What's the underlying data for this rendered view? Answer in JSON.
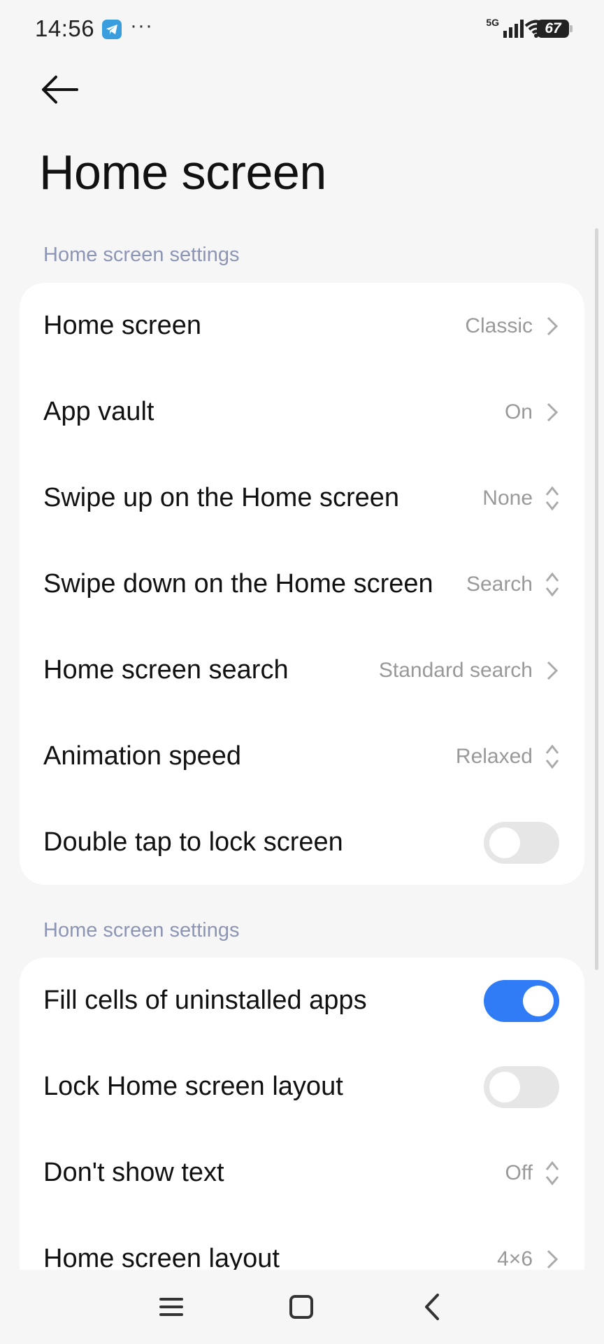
{
  "status_bar": {
    "time": "14:56",
    "more": "···",
    "network": "5G",
    "battery": "67"
  },
  "header": {
    "title": "Home screen"
  },
  "sections": [
    {
      "label": "Home screen settings",
      "rows": [
        {
          "label": "Home screen",
          "value": "Classic",
          "control": "chevron"
        },
        {
          "label": "App vault",
          "value": "On",
          "control": "chevron"
        },
        {
          "label": "Swipe up on the Home screen",
          "value": "None",
          "control": "updown"
        },
        {
          "label": "Swipe down on the Home screen",
          "value": "Search",
          "control": "updown"
        },
        {
          "label": "Home screen search",
          "value": "Standard search",
          "control": "chevron"
        },
        {
          "label": "Animation speed",
          "value": "Relaxed",
          "control": "updown"
        },
        {
          "label": "Double tap to lock screen",
          "control": "toggle",
          "on": false
        }
      ]
    },
    {
      "label": "Home screen settings",
      "rows": [
        {
          "label": "Fill cells of uninstalled apps",
          "control": "toggle",
          "on": true
        },
        {
          "label": "Lock Home screen layout",
          "control": "toggle",
          "on": false
        },
        {
          "label": "Don't show text",
          "value": "Off",
          "control": "updown"
        },
        {
          "label": "Home screen layout",
          "value": "4×6",
          "control": "chevron"
        }
      ]
    }
  ],
  "colors": {
    "accent": "#2f7cf6",
    "section_label": "#8d95b4",
    "secondary_text": "#999999",
    "background": "#f6f6f6"
  },
  "icons": {
    "back": "arrow-left-icon",
    "chevron": "chevron-right-icon",
    "updown": "up-down-arrows-icon",
    "nav_menu": "menu-icon",
    "nav_home": "home-square-icon",
    "nav_back": "back-chevron-icon"
  }
}
